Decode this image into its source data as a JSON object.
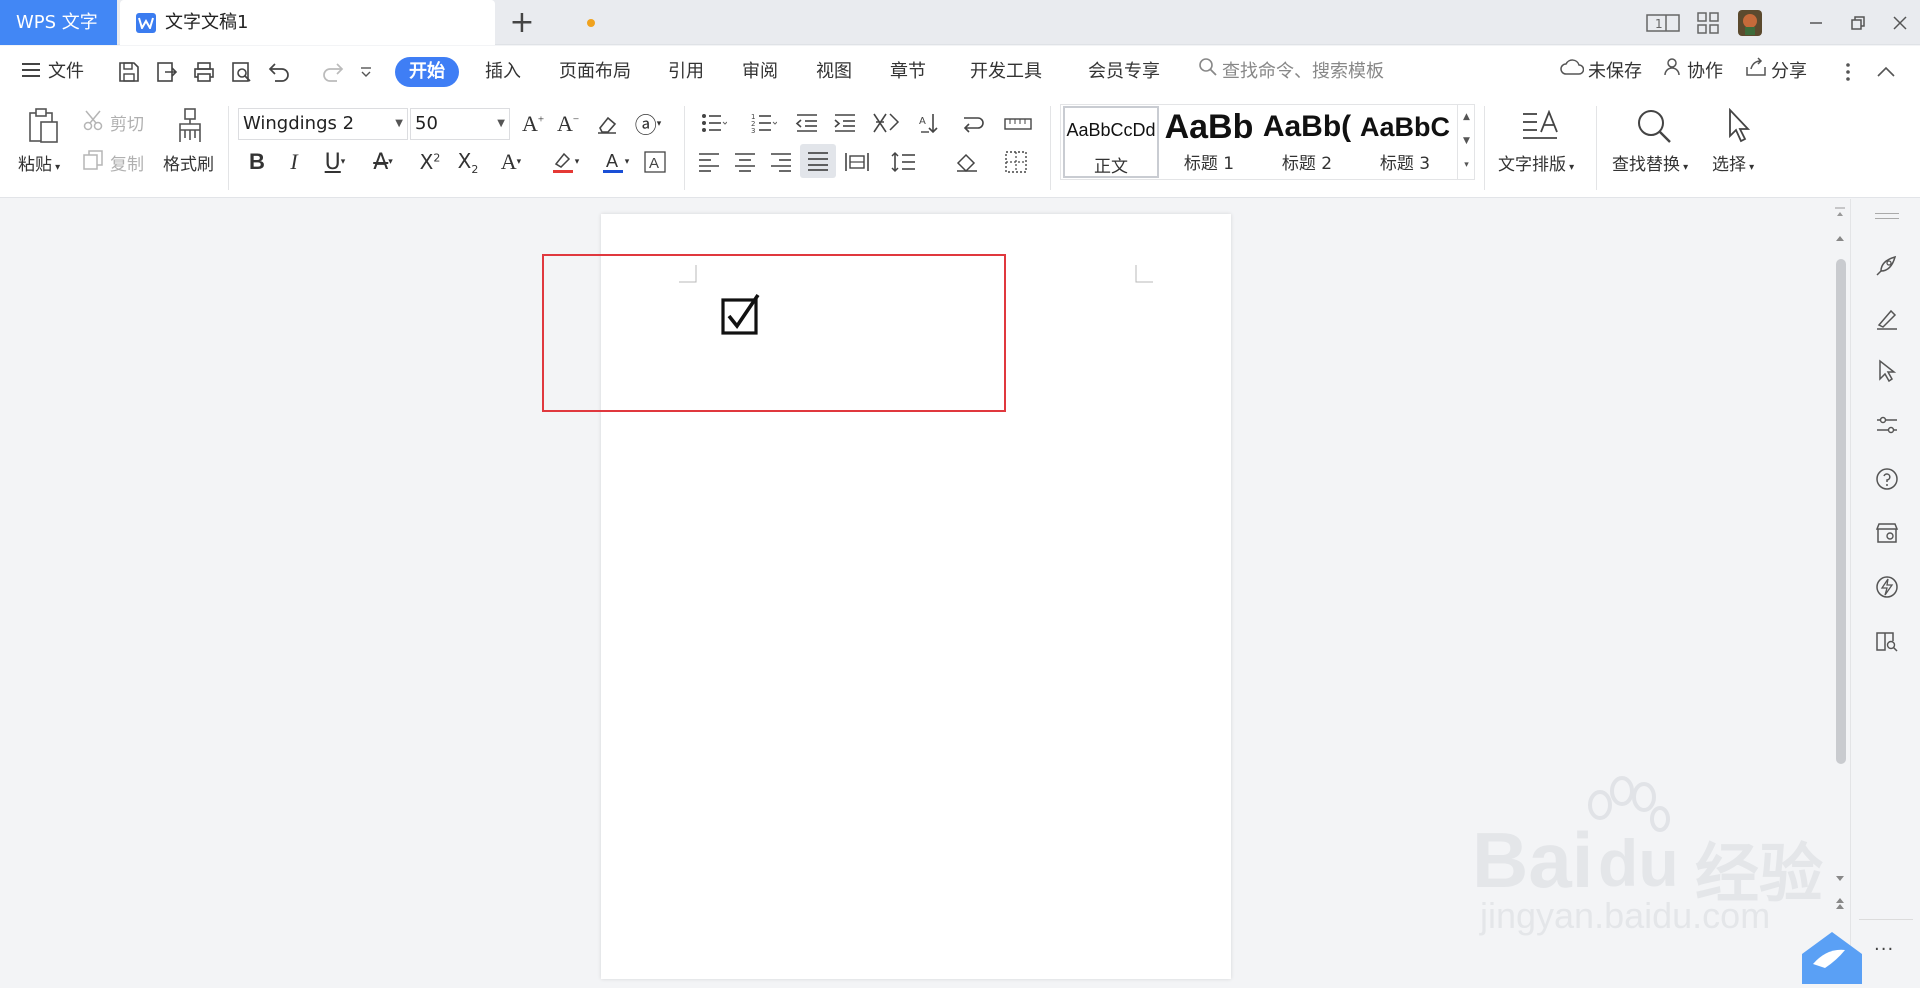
{
  "titlebar": {
    "app_tab": "WPS 文字",
    "doc_tab": "文字文稿1",
    "page_indicator": "1"
  },
  "menubar": {
    "file": "文件",
    "tabs": [
      "开始",
      "插入",
      "页面布局",
      "引用",
      "审阅",
      "视图",
      "章节",
      "开发工具",
      "会员专享"
    ],
    "search_placeholder": "查找命令、搜索模板",
    "unsaved": "未保存",
    "collaborate": "协作",
    "share": "分享"
  },
  "ribbon": {
    "paste": "粘贴",
    "cut": "剪切",
    "copy": "复制",
    "format_painter": "格式刷",
    "font_name": "Wingdings 2",
    "font_size": "50",
    "styles": [
      {
        "preview": "AaBbCcDd",
        "name": "正文"
      },
      {
        "preview": "AaBb",
        "name": "标题 1"
      },
      {
        "preview": "AaBb(",
        "name": "标题 2"
      },
      {
        "preview": "AaBbC",
        "name": "标题 3"
      }
    ],
    "text_layout": "文字排版",
    "find_replace": "查找替换",
    "select": "选择"
  },
  "colors": {
    "accent": "#3f7ef5",
    "highlight_box": "#e0383e",
    "font_color_bar": "#1a4fd6",
    "highlight_color_bar": "#e53935"
  },
  "watermark": {
    "brand": "Bai",
    "brand2": "du",
    "cn": "经验",
    "url": "jingyan.baidu.com"
  },
  "right_panel": {
    "more": "···"
  }
}
